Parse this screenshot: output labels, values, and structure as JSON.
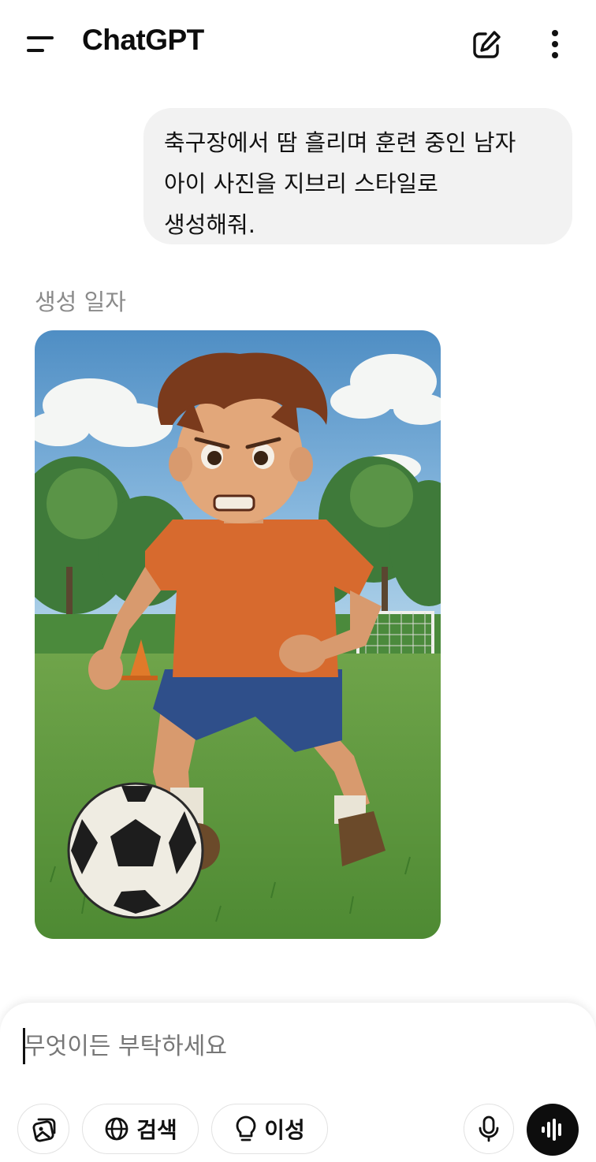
{
  "header": {
    "title": "ChatGPT"
  },
  "conversation": {
    "user_message": "축구장에서 땀 흘리며 훈련 중인 남자\n아이 사진을 지브리 스타일로\n생성해줘.",
    "image_label": "생성 일자"
  },
  "composer": {
    "placeholder": "무엇이든 부탁하세요",
    "search_label": "검색",
    "reason_label": "이성"
  },
  "icons": {
    "menu": "menu-icon",
    "compose": "new-chat-icon",
    "more": "more-vertical-icon",
    "attach": "attach-image-icon",
    "search": "globe-icon",
    "reason": "lightbulb-icon",
    "mic": "microphone-icon",
    "voice": "voice-mode-icon"
  },
  "colors": {
    "bubble": "#f2f2f2",
    "voice_button": "#0d0d0d",
    "muted_text": "#8a8a8a"
  }
}
